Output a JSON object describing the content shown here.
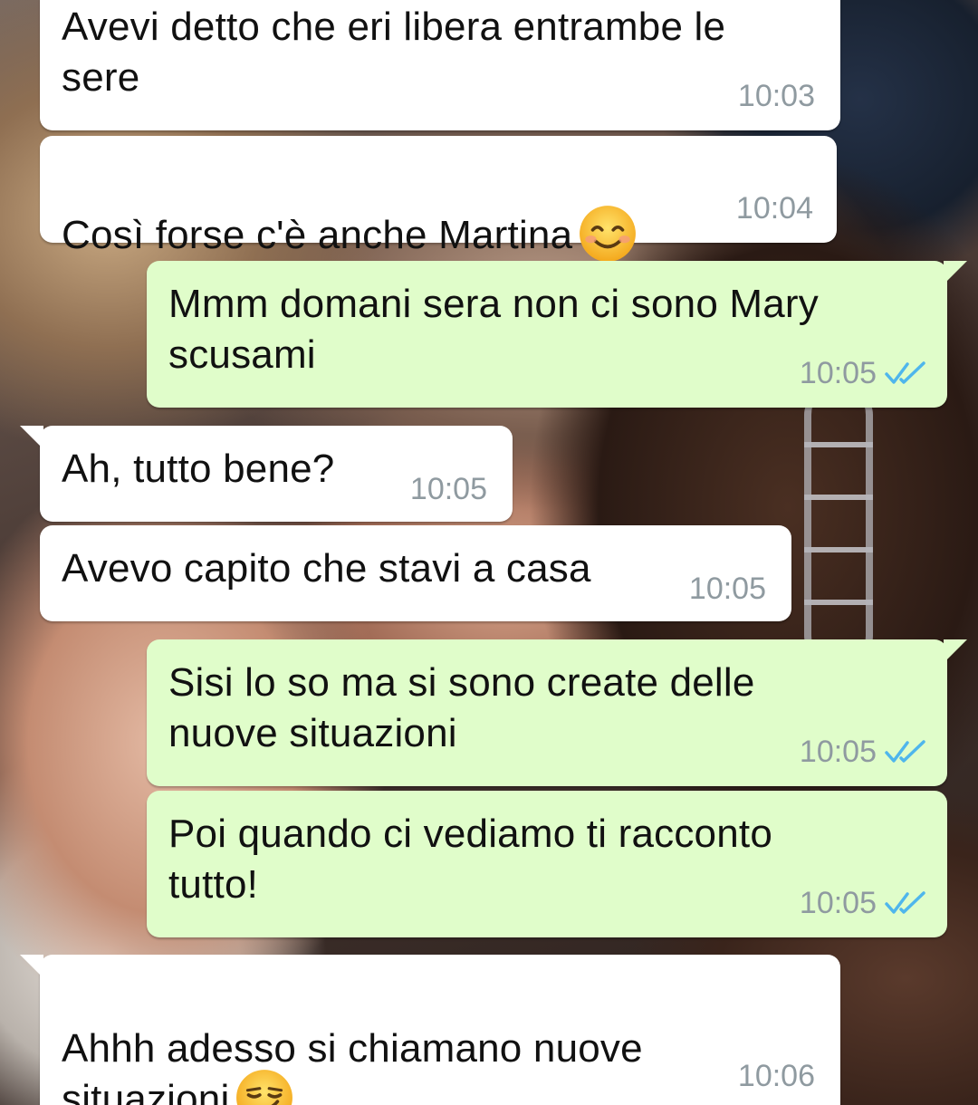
{
  "wallpaper": {
    "description_icon": "photo-wallpaper"
  },
  "colors": {
    "incoming_bubble": "#ffffff",
    "outgoing_bubble": "#e0fdca",
    "timestamp": "#8f9aa0",
    "read_ticks": "#4fb6ec"
  },
  "messages": [
    {
      "direction": "incoming",
      "text": "Avevi detto che eri libera entrambe le\nsere",
      "time": "10:03"
    },
    {
      "direction": "incoming",
      "text": "Così forse c'è anche Martina",
      "emoji": "smiling-face-icon",
      "time": "10:04"
    },
    {
      "direction": "outgoing",
      "text": "Mmm domani sera non ci sono Mary\nscusami",
      "time": "10:05",
      "status": "read"
    },
    {
      "direction": "incoming",
      "text": "Ah, tutto bene?",
      "time": "10:05"
    },
    {
      "direction": "incoming",
      "text": "Avevo capito che stavi a casa",
      "time": "10:05"
    },
    {
      "direction": "outgoing",
      "text": "Sisi lo so ma si sono create delle\nnuove situazioni",
      "time": "10:05",
      "status": "read"
    },
    {
      "direction": "outgoing",
      "text": "Poi quando ci vediamo ti racconto\ntutto!",
      "time": "10:05",
      "status": "read"
    },
    {
      "direction": "incoming",
      "text": "Ahhh adesso si chiamano nuove\nsituazioni",
      "emoji": "smirking-face-icon",
      "time": "10:06"
    }
  ]
}
